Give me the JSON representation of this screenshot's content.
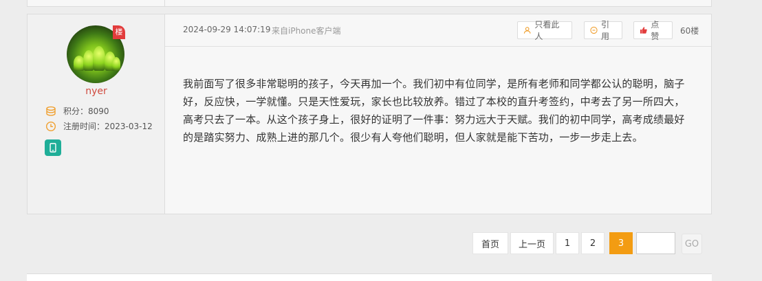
{
  "post": {
    "user": {
      "badge": "楼",
      "name": "nyer",
      "points_label": "积分：",
      "points_value": "8090",
      "reg_label": "注册时间：",
      "reg_value": "2023-03-12",
      "device_icon": "mobile-phone-icon"
    },
    "time": "2024-09-29 14:07:19",
    "source": "来自iPhone客户端",
    "actions": {
      "only_author": "只看此人",
      "quote": "引用",
      "like": "点赞"
    },
    "floor": "60楼",
    "body": "我前面写了很多非常聪明的孩子，今天再加一个。我们初中有位同学，是所有老师和同学都公认的聪明，脑子好，反应快，一学就懂。只是天性爱玩，家长也比较放养。错过了本校的直升考签约，中考去了另一所四大，高考只去了一本。从这个孩子身上，很好的证明了一件事：努力远大于天赋。我们的初中同学，高考成绩最好的是踏实努力、成熟上进的那几个。很少有人夸他们聪明，但人家就是能下苦功，一步一步走上去。"
  },
  "pagination": {
    "first": "首页",
    "prev": "上一页",
    "pages": [
      "1",
      "2",
      "3"
    ],
    "current": "3",
    "go_label": "GO",
    "go_input_value": ""
  },
  "colors": {
    "accent_orange": "#f39c12",
    "username_red": "#d04a3e",
    "device_teal": "#1fae98",
    "like_red": "#e23c3c"
  }
}
